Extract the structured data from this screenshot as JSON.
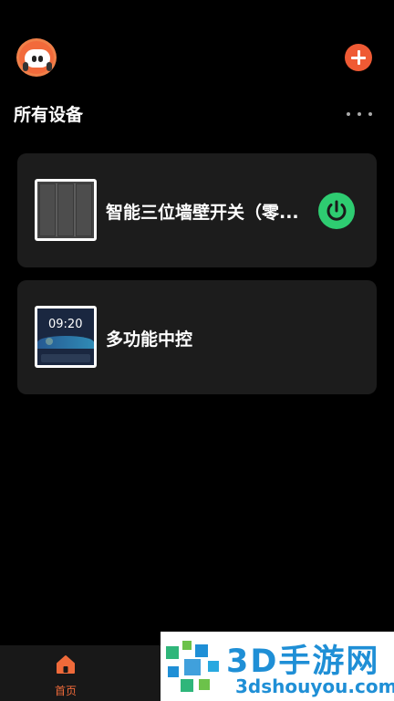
{
  "header": {
    "avatar_icon": "robot-avatar-icon",
    "add_icon": "plus-icon"
  },
  "section": {
    "title": "所有设备",
    "more_icon": "more-horizontal-icon"
  },
  "devices": [
    {
      "name": "智能三位墙壁开关（零...",
      "image": "three-gang-switch",
      "power_state": "on",
      "power_color": "#2ecc71"
    },
    {
      "name": "多功能中控",
      "image": "smart-panel",
      "panel_time": "09:20"
    }
  ],
  "tabbar": {
    "items": [
      {
        "label": "首页",
        "icon": "home-icon",
        "active": true
      }
    ],
    "accent": "#ef6a3a"
  },
  "watermark": {
    "title": "3D手游网",
    "url": "3dshouyou.com"
  },
  "colors": {
    "accent": "#ef5a34",
    "card_bg": "#1c1c1c",
    "power_on": "#2ecc71"
  }
}
